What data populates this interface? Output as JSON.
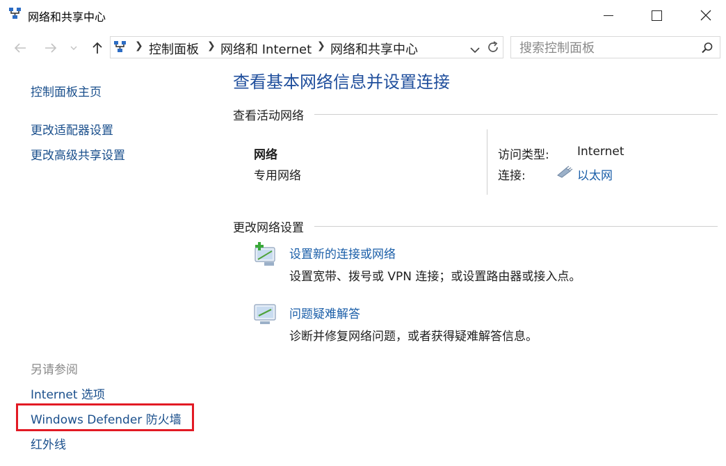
{
  "window": {
    "title": "网络和共享中心",
    "icon": "network-icon",
    "controls": [
      "minimize-icon",
      "maximize-icon",
      "close-icon"
    ]
  },
  "toolbar": {
    "back_icon": "arrow-left-icon",
    "forward_icon": "arrow-right-icon",
    "recent_icon": "chevron-down-icon",
    "up_icon": "arrow-up-icon",
    "breadcrumb": [
      "控制面板",
      "网络和 Internet",
      "网络和共享中心"
    ],
    "refresh_icon": "refresh-icon",
    "search_placeholder": "搜索控制面板"
  },
  "sidebar": {
    "home": "控制面板主页",
    "links": [
      "更改适配器设置",
      "更改高级共享设置"
    ],
    "see_also_title": "另请参阅",
    "see_also": [
      "Internet 选项",
      "Windows Defender 防火墙",
      "红外线"
    ]
  },
  "main": {
    "title": "查看基本网络信息并设置连接",
    "active_section": "查看活动网络",
    "network": {
      "name": "网络",
      "type": "专用网络",
      "access_label": "访问类型:",
      "access_value": "Internet",
      "connection_label": "连接:",
      "connection_value": "以太网"
    },
    "change_section": "更改网络设置",
    "tasks": [
      {
        "title": "设置新的连接或网络",
        "desc": "设置宽带、拨号或 VPN 连接；或设置路由器或接入点。",
        "icon": "new-connection-icon"
      },
      {
        "title": "问题疑难解答",
        "desc": "诊断并修复网络问题，或者获得疑难解答信息。",
        "icon": "troubleshoot-icon"
      }
    ]
  },
  "colors": {
    "link": "#1a5ea8",
    "title": "#1f4e9c",
    "highlight": "#e21a24"
  }
}
